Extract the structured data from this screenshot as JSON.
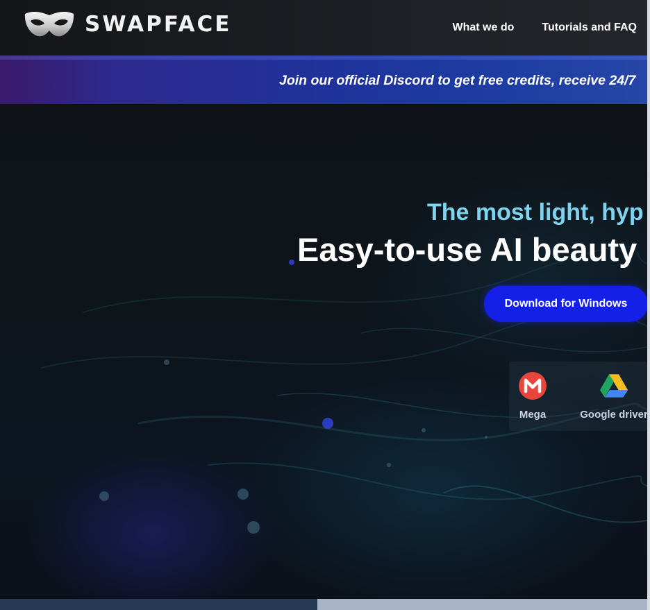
{
  "header": {
    "brand": "SWAPFACE",
    "logo_icon": "mask-icon",
    "nav": [
      {
        "label": "What we do"
      },
      {
        "label": "Tutorials and FAQ"
      }
    ]
  },
  "banner": {
    "text": "Join our official Discord to get free credits, receive 24/7"
  },
  "hero": {
    "subtitle": "The most light, hyp",
    "headline": "Easy-to-use AI beauty",
    "download_label": "Download for Windows",
    "mirrors": [
      {
        "label": "Mega",
        "icon": "mega-icon"
      },
      {
        "label": "Google driver",
        "icon": "google-drive-icon"
      }
    ]
  },
  "colors": {
    "accent_button": "#1420e8",
    "subtitle": "#7fd3ee",
    "header_bg": "#1d2024",
    "mega_red": "#e8453c"
  }
}
